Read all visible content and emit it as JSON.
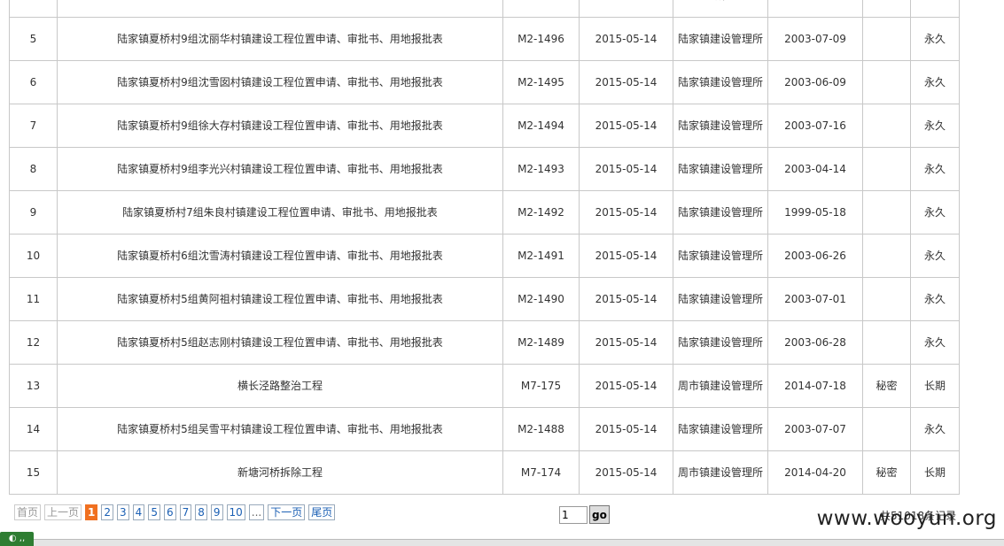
{
  "table": {
    "rows": [
      {
        "no": "",
        "title": "",
        "code": "",
        "date": "",
        "unit": "所",
        "form_date": "",
        "secret": "",
        "term": ""
      },
      {
        "no": "5",
        "title": "陆家镇夏桥村9组沈丽华村镇建设工程位置申请、审批书、用地报批表",
        "code": "M2-1496",
        "date": "2015-05-14",
        "unit": "陆家镇建设管理所",
        "form_date": "2003-07-09",
        "secret": "",
        "term": "永久"
      },
      {
        "no": "6",
        "title": "陆家镇夏桥村9组沈雪囡村镇建设工程位置申请、审批书、用地报批表",
        "code": "M2-1495",
        "date": "2015-05-14",
        "unit": "陆家镇建设管理所",
        "form_date": "2003-06-09",
        "secret": "",
        "term": "永久"
      },
      {
        "no": "7",
        "title": "陆家镇夏桥村9组徐大存村镇建设工程位置申请、审批书、用地报批表",
        "code": "M2-1494",
        "date": "2015-05-14",
        "unit": "陆家镇建设管理所",
        "form_date": "2003-07-16",
        "secret": "",
        "term": "永久"
      },
      {
        "no": "8",
        "title": "陆家镇夏桥村9组李光兴村镇建设工程位置申请、审批书、用地报批表",
        "code": "M2-1493",
        "date": "2015-05-14",
        "unit": "陆家镇建设管理所",
        "form_date": "2003-04-14",
        "secret": "",
        "term": "永久"
      },
      {
        "no": "9",
        "title": "陆家镇夏桥村7组朱良村镇建设工程位置申请、审批书、用地报批表",
        "code": "M2-1492",
        "date": "2015-05-14",
        "unit": "陆家镇建设管理所",
        "form_date": "1999-05-18",
        "secret": "",
        "term": "永久"
      },
      {
        "no": "10",
        "title": "陆家镇夏桥村6组沈雪涛村镇建设工程位置申请、审批书、用地报批表",
        "code": "M2-1491",
        "date": "2015-05-14",
        "unit": "陆家镇建设管理所",
        "form_date": "2003-06-26",
        "secret": "",
        "term": "永久"
      },
      {
        "no": "11",
        "title": "陆家镇夏桥村5组黄阿祖村镇建设工程位置申请、审批书、用地报批表",
        "code": "M2-1490",
        "date": "2015-05-14",
        "unit": "陆家镇建设管理所",
        "form_date": "2003-07-01",
        "secret": "",
        "term": "永久"
      },
      {
        "no": "12",
        "title": "陆家镇夏桥村5组赵志刚村镇建设工程位置申请、审批书、用地报批表",
        "code": "M2-1489",
        "date": "2015-05-14",
        "unit": "陆家镇建设管理所",
        "form_date": "2003-06-28",
        "secret": "",
        "term": "永久"
      },
      {
        "no": "13",
        "title": "横长泾路整治工程",
        "code": "M7-175",
        "date": "2015-05-14",
        "unit": "周市镇建设管理所",
        "form_date": "2014-07-18",
        "secret": "秘密",
        "term": "长期"
      },
      {
        "no": "14",
        "title": "陆家镇夏桥村5组吴雪平村镇建设工程位置申请、审批书、用地报批表",
        "code": "M2-1488",
        "date": "2015-05-14",
        "unit": "陆家镇建设管理所",
        "form_date": "2003-07-07",
        "secret": "",
        "term": "永久"
      },
      {
        "no": "15",
        "title": "新塘河桥拆除工程",
        "code": "M7-174",
        "date": "2015-05-14",
        "unit": "周市镇建设管理所",
        "form_date": "2014-04-20",
        "secret": "秘密",
        "term": "长期"
      }
    ]
  },
  "pagination": {
    "first": "首页",
    "prev": "上一页",
    "pages": [
      "1",
      "2",
      "3",
      "4",
      "5",
      "6",
      "7",
      "8",
      "9",
      "10"
    ],
    "current_page": "1",
    "ellipsis": "...",
    "next": "下一页",
    "last": "尾页",
    "jump_value": "1",
    "go_label": "go",
    "total": "共51018条记录"
  },
  "watermark": "www.wooyun.org",
  "colors": {
    "current_page": "#f07020",
    "link": "#1a5fb4",
    "border": "#c8c8c8"
  }
}
